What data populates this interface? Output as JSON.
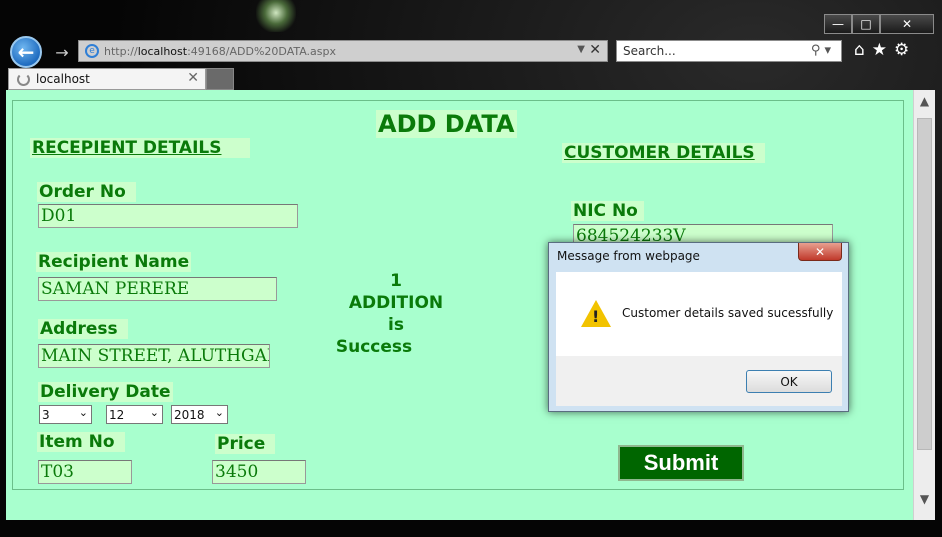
{
  "browser": {
    "url_prefix": "http://",
    "url_host": "localhost",
    "url_rest": ":49168/ADD%20DATA.aspx",
    "search_placeholder": "Search...",
    "tab_label": "localhost",
    "icons": {
      "back": "back-arrow-icon",
      "forward": "forward-arrow-icon",
      "home": "home-icon",
      "favorites": "star-icon",
      "tools": "gear-icon",
      "search": "magnifier-icon"
    }
  },
  "page": {
    "title": "ADD DATA",
    "recipient_heading": "RECEPIENT DETAILS",
    "customer_heading": "CUSTOMER DETAILS",
    "order_no_label": "Order No",
    "order_no_value": "D01",
    "recipient_name_label": "Recipient Name",
    "recipient_name_value": "SAMAN PERERE",
    "address_label": "Address",
    "address_value": "MAIN STREET, ALUTHGAMA",
    "delivery_date_label": "Delivery Date",
    "day_value": "3",
    "month_value": "12",
    "year_value": "2018",
    "item_no_label": "Item No",
    "item_no_value": "T03",
    "price_label": "Price",
    "price_value": "3450",
    "nic_label": "NIC No",
    "nic_value": "684524233V",
    "status_lines": [
      "1",
      "ADDITION",
      "is",
      "Success"
    ],
    "submit_label": "Submit"
  },
  "dialog": {
    "title": "Message from webpage",
    "message": "Customer details saved sucessfully",
    "ok_label": "OK",
    "icon": "warning-icon"
  },
  "colors": {
    "page_bg": "#a8ffce",
    "field_bg": "#ccffcc",
    "label_green": "#0a7a0a",
    "submit_bg": "#006600"
  }
}
